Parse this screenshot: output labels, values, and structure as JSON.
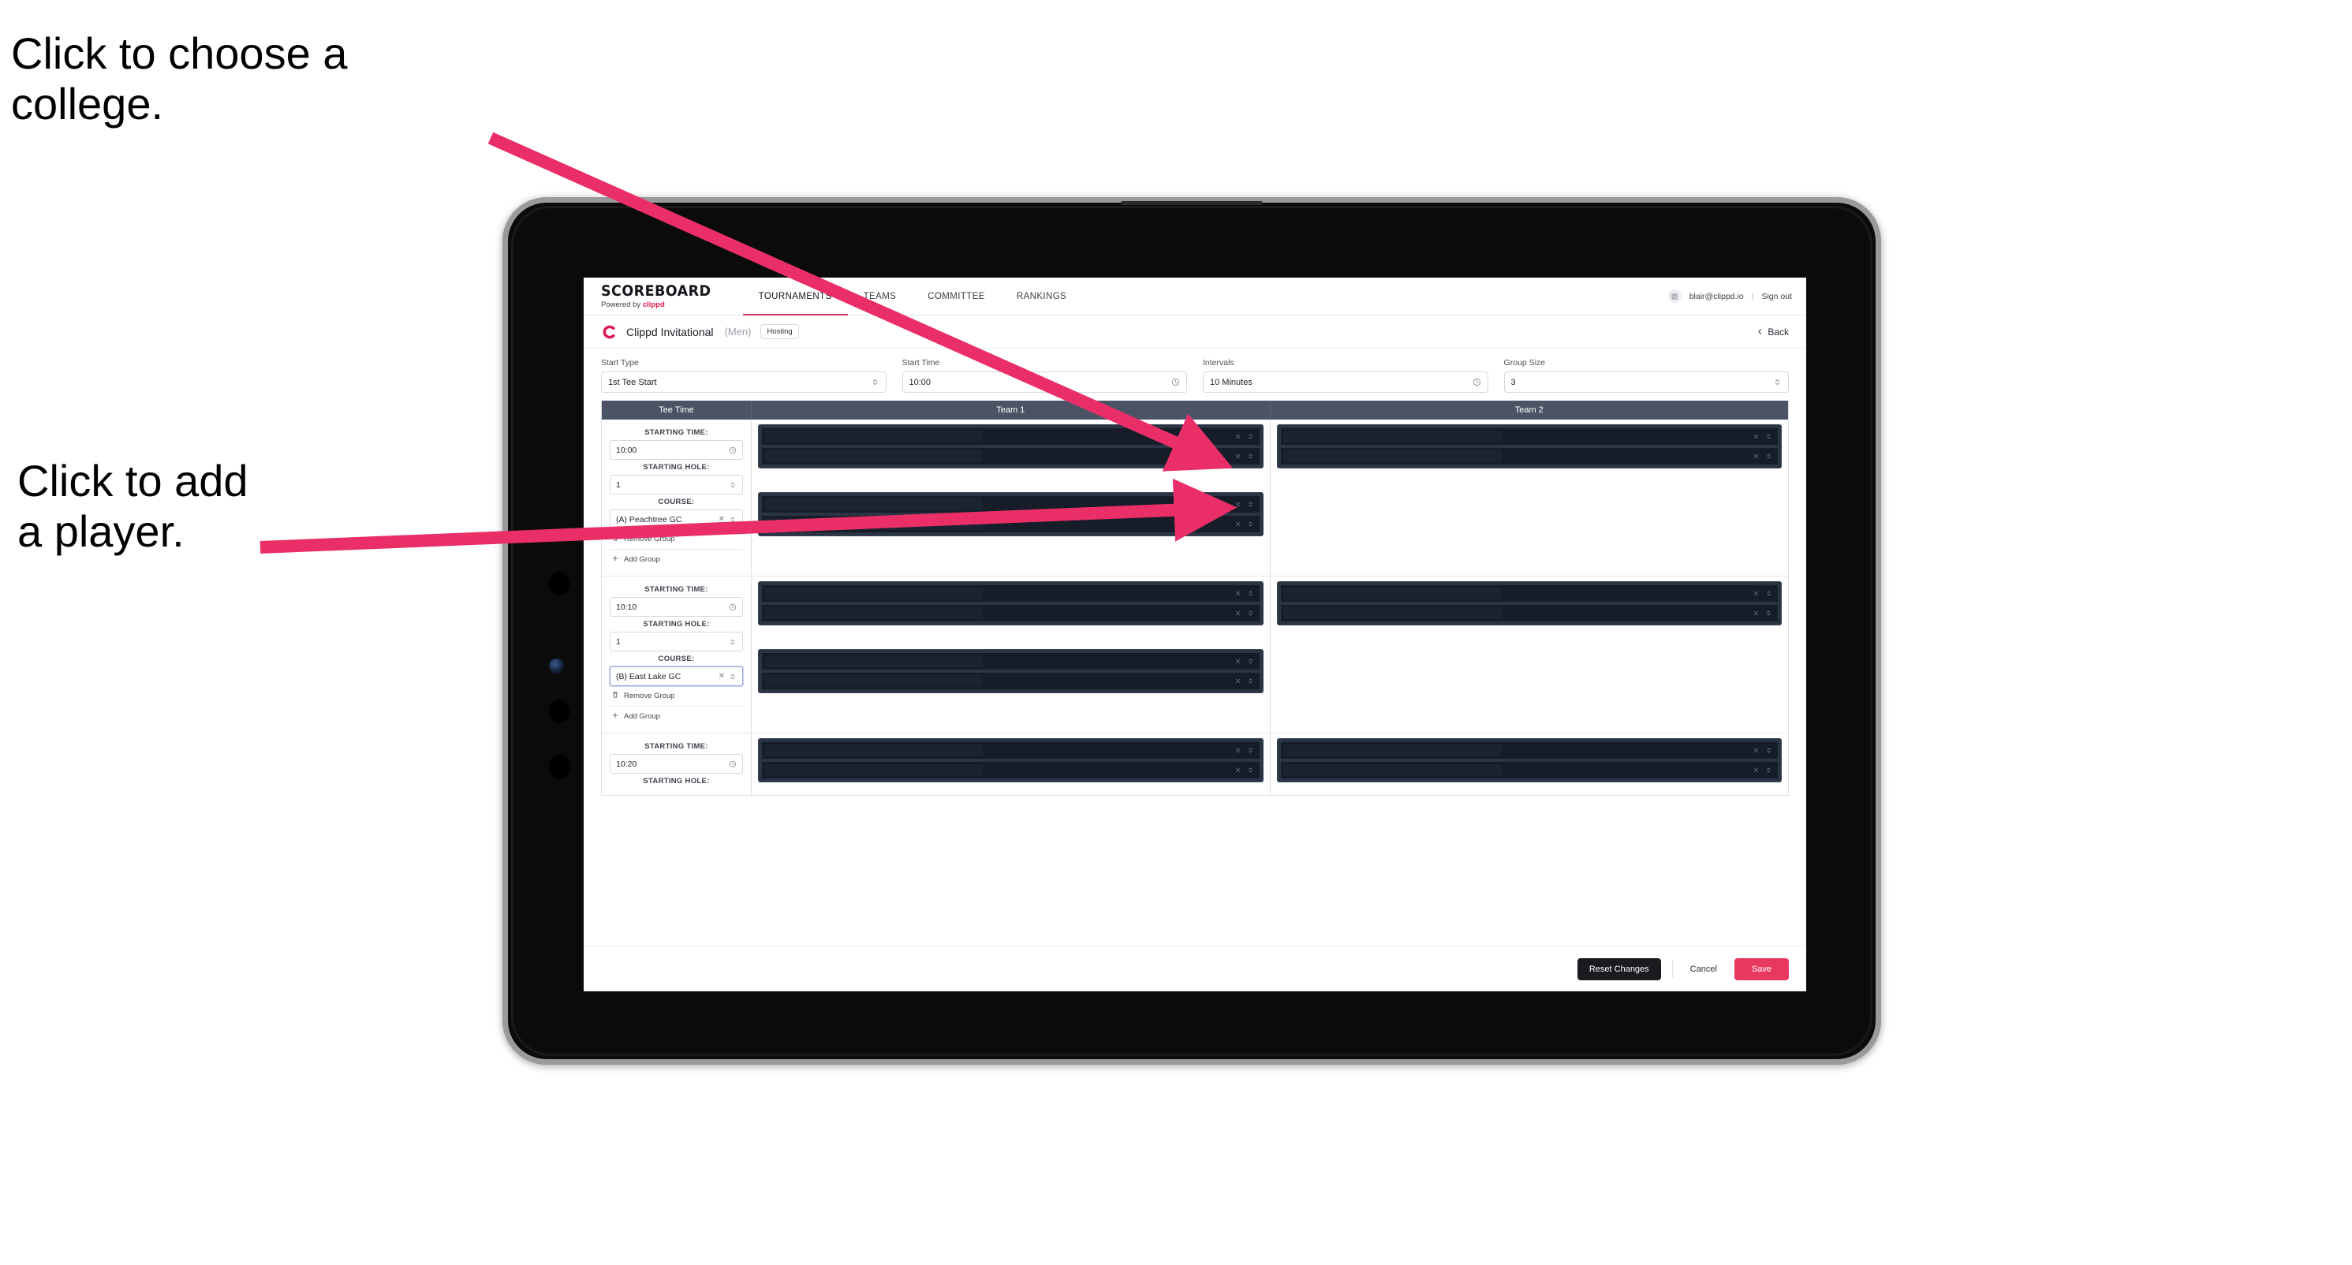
{
  "annotations": [
    {
      "id": "choose-college",
      "text": "Click to choose a\ncollege."
    },
    {
      "id": "add-player",
      "text": "Click to add\na player."
    }
  ],
  "colors": {
    "accent_pink": "#e8385f",
    "brand_red": "#d81b52",
    "table_header": "#4b5364",
    "player_row_dark": "#161d28",
    "annotation_arrow": "#ea2f68"
  },
  "app": {
    "brand": {
      "name": "SCOREBOARD",
      "tagline_prefix": "Powered by ",
      "tagline_brand": "clippd"
    },
    "nav": [
      {
        "label": "TOURNAMENTS",
        "active": true
      },
      {
        "label": "TEAMS",
        "active": false
      },
      {
        "label": "COMMITTEE",
        "active": false
      },
      {
        "label": "RANKINGS",
        "active": false
      }
    ],
    "account": {
      "email": "blair@clippd.io",
      "separator": "|",
      "sign_out": "Sign out"
    },
    "tournament": {
      "title": "Clippd Invitational",
      "gender": "(Men)",
      "badge": "Hosting",
      "back_label": "Back"
    },
    "filters": [
      {
        "label": "Start Type",
        "value": "1st Tee Start",
        "icon": "stepper-icon"
      },
      {
        "label": "Start Time",
        "value": "10:00",
        "icon": "clock-icon"
      },
      {
        "label": "Intervals",
        "value": "10 Minutes",
        "icon": "clock-icon"
      },
      {
        "label": "Group Size",
        "value": "3",
        "icon": "stepper-icon"
      }
    ],
    "table": {
      "headers": {
        "tee_time": "Tee Time",
        "team1": "Team 1",
        "team2": "Team 2"
      },
      "field_labels": {
        "starting_time": "STARTING TIME:",
        "starting_hole": "STARTING HOLE:",
        "course": "COURSE:"
      },
      "group_actions": {
        "remove": "Remove Group",
        "add": "Add Group"
      },
      "rows": [
        {
          "starting_time": "10:00",
          "starting_hole": "1",
          "course": "(A) Peachtree GC",
          "course_focused": false,
          "team1_groups": 2,
          "team2_groups": 1
        },
        {
          "starting_time": "10:10",
          "starting_hole": "1",
          "course": "(B) East Lake GC",
          "course_focused": true,
          "team1_groups": 2,
          "team2_groups": 1
        },
        {
          "starting_time": "10:20",
          "starting_hole": "",
          "course": "",
          "course_focused": false,
          "team1_groups": 1,
          "team2_groups": 1
        }
      ]
    },
    "footer": {
      "reset_label": "Reset Changes",
      "cancel_label": "Cancel",
      "save_label": "Save"
    }
  }
}
